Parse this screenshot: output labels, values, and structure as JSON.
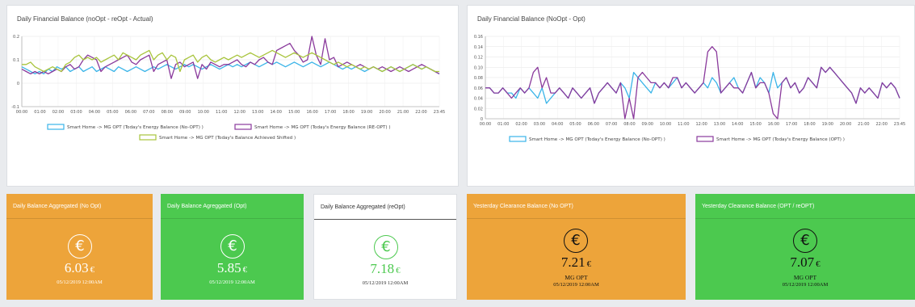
{
  "panels": {
    "left_title": "Daily Financial Balance (noOpt - reOpt - Actual)",
    "right_title": "Daily Financial Balance (NoOpt - Opt)"
  },
  "colors": {
    "blue": "#3ab4e8",
    "purple": "#8a3a9c",
    "olive": "#a8c43c",
    "orange": "#eda43a",
    "green": "#4cc94f"
  },
  "chart_data": [
    {
      "type": "line",
      "title": "Daily Financial Balance (noOpt - reOpt - Actual)",
      "ylim": [
        -0.1,
        0.2
      ],
      "yticks": [
        "0.2",
        "0.1",
        "0",
        "-0.1"
      ],
      "x_ticks": [
        "00:00",
        "01:00",
        "02:00",
        "03:00",
        "04:00",
        "05:00",
        "06:00",
        "07:00",
        "08:00",
        "09:00",
        "10:00",
        "11:00",
        "12:00",
        "13:00",
        "14:00",
        "15:00",
        "16:00",
        "17:00",
        "18:00",
        "19:00",
        "20:00",
        "21:00",
        "22:00",
        "23:45"
      ],
      "grid": true,
      "legend_position": "bottom",
      "series": [
        {
          "name": "Smart Home -> MG OPT (Today's Energy Balance (No-OPT) )",
          "color": "#3ab4e8",
          "values": [
            0.07,
            0.06,
            0.05,
            0.04,
            0.05,
            0.04,
            0.06,
            0.05,
            0.07,
            0.06,
            0.07,
            0.05,
            0.06,
            0.07,
            0.05,
            0.06,
            0.07,
            0.05,
            0.06,
            0.07,
            0.06,
            0.05,
            0.07,
            0.06,
            0.05,
            0.06,
            0.07,
            0.06,
            0.05,
            0.06,
            0.07,
            0.06,
            0.07,
            0.08,
            0.07,
            0.06,
            0.07,
            0.08,
            0.07,
            0.08,
            0.07,
            0.06,
            0.07,
            0.08,
            0.07,
            0.06,
            0.07,
            0.08,
            0.07,
            0.08,
            0.07,
            0.08,
            0.09,
            0.08,
            0.07,
            0.08,
            0.09,
            0.08,
            0.09,
            0.08,
            0.07,
            0.08,
            0.09,
            0.08,
            0.07,
            0.08,
            0.09,
            0.08,
            0.07,
            0.08,
            0.09,
            0.08,
            0.07,
            0.06,
            0.07,
            0.06,
            0.07,
            0.06,
            0.05,
            0.06,
            0.07,
            0.06,
            0.05,
            0.06,
            0.07,
            0.06,
            0.05,
            0.06,
            0.07,
            0.08,
            0.07,
            0.06,
            0.07,
            0.06,
            0.05,
            0.04
          ]
        },
        {
          "name": "Smart Home -> MG OPT (Today's Energy Balance (RE-OPT) )",
          "color": "#8a3a9c",
          "values": [
            0.06,
            0.05,
            0.04,
            0.05,
            0.04,
            0.05,
            0.04,
            0.05,
            0.06,
            0.05,
            0.07,
            0.08,
            0.06,
            0.07,
            0.1,
            0.12,
            0.11,
            0.1,
            0.05,
            0.07,
            0.08,
            0.09,
            0.1,
            0.11,
            0.12,
            0.09,
            0.08,
            0.1,
            0.11,
            0.12,
            0.05,
            0.08,
            0.09,
            0.1,
            0.02,
            0.08,
            0.09,
            0.07,
            0.08,
            0.09,
            0.02,
            0.08,
            0.06,
            0.09,
            0.08,
            0.07,
            0.08,
            0.08,
            0.09,
            0.1,
            0.08,
            0.07,
            0.09,
            0.08,
            0.1,
            0.11,
            0.09,
            0.08,
            0.14,
            0.15,
            0.16,
            0.17,
            0.14,
            0.12,
            0.09,
            0.1,
            0.2,
            0.12,
            0.08,
            0.19,
            0.1,
            0.11,
            0.07,
            0.08,
            0.09,
            0.08,
            0.07,
            0.08,
            0.07,
            0.06,
            0.07,
            0.06,
            0.07,
            0.06,
            0.05,
            0.06,
            0.07,
            0.06,
            0.05,
            0.06,
            0.07,
            0.08,
            0.07,
            0.06,
            0.05,
            0.04
          ]
        },
        {
          "name": "Smart Home -> MG OPT (Today's Balance Achieved Shifted )",
          "color": "#a8c43c",
          "values": [
            0.08,
            0.08,
            0.09,
            0.07,
            0.06,
            0.05,
            0.06,
            0.07,
            0.06,
            0.05,
            0.08,
            0.09,
            0.11,
            0.12,
            0.1,
            0.11,
            0.1,
            0.11,
            0.09,
            0.1,
            0.11,
            0.12,
            0.1,
            0.13,
            0.12,
            0.11,
            0.1,
            0.12,
            0.13,
            0.14,
            0.1,
            0.12,
            0.13,
            0.1,
            0.12,
            0.11,
            0.05,
            0.1,
            0.11,
            0.12,
            0.09,
            0.11,
            0.12,
            0.1,
            0.09,
            0.1,
            0.11,
            0.1,
            0.11,
            0.12,
            0.11,
            0.12,
            0.13,
            0.12,
            0.11,
            0.12,
            0.13,
            0.14,
            0.13,
            0.12,
            0.11,
            0.12,
            0.13,
            0.12,
            0.11,
            0.12,
            0.13,
            0.12,
            0.11,
            0.1,
            0.09,
            0.08,
            0.09,
            0.08,
            0.07,
            0.08,
            0.07,
            0.06,
            0.07,
            0.06,
            0.07,
            0.06,
            0.05,
            0.06,
            0.07,
            0.06,
            0.05,
            0.06,
            0.07,
            0.08,
            0.07,
            0.06,
            0.07,
            0.06,
            0.05,
            0.05
          ]
        }
      ]
    },
    {
      "type": "line",
      "title": "Daily Financial Balance (NoOpt - Opt)",
      "ylim": [
        0,
        0.16
      ],
      "yticks": [
        "0.16",
        "0.14",
        "0.12",
        "0.10",
        "0.08",
        "0.06",
        "0.04",
        "0.02",
        "0"
      ],
      "x_ticks": [
        "00:00",
        "01:00",
        "02:00",
        "03:00",
        "04:00",
        "05:00",
        "06:00",
        "07:00",
        "08:00",
        "09:00",
        "10:00",
        "11:00",
        "12:00",
        "13:00",
        "14:00",
        "15:00",
        "16:00",
        "17:00",
        "18:00",
        "19:00",
        "20:00",
        "21:00",
        "22:00",
        "23:45"
      ],
      "grid": true,
      "legend_position": "bottom",
      "series": [
        {
          "name": "Smart Home -> MG OPT (Today's Energy Balance (No-OPT) )",
          "color": "#3ab4e8",
          "values": [
            0.06,
            0.06,
            0.05,
            0.05,
            0.06,
            0.05,
            0.05,
            0.04,
            0.06,
            0.05,
            0.06,
            0.05,
            0.04,
            0.06,
            0.03,
            0.04,
            0.05,
            0.06,
            0.05,
            0.04,
            0.06,
            0.05,
            0.04,
            0.05,
            0.06,
            0.03,
            0.05,
            0.06,
            0.07,
            0.06,
            0.05,
            0.07,
            0.06,
            0.04,
            0.09,
            0.08,
            0.07,
            0.06,
            0.05,
            0.07,
            0.06,
            0.07,
            0.06,
            0.07,
            0.08,
            0.06,
            0.07,
            0.06,
            0.05,
            0.06,
            0.07,
            0.06,
            0.08,
            0.07,
            0.05,
            0.06,
            0.07,
            0.08,
            0.06,
            0.05,
            0.07,
            0.09,
            0.06,
            0.08,
            0.07,
            0.05,
            0.09,
            0.06,
            0.07,
            0.08,
            0.06,
            0.07,
            0.05,
            0.06,
            0.08,
            0.07,
            0.06,
            0.1,
            0.09,
            0.1,
            0.09,
            0.08,
            0.07,
            0.06,
            0.05,
            0.03,
            0.06,
            0.05,
            0.06,
            0.05,
            0.04,
            0.07,
            0.06,
            0.07,
            0.06,
            0.04
          ]
        },
        {
          "name": "Smart Home -> MG OPT (Today's Energy Balance (OPT) )",
          "color": "#8a3a9c",
          "values": [
            0.06,
            0.06,
            0.05,
            0.05,
            0.06,
            0.05,
            0.04,
            0.05,
            0.06,
            0.05,
            0.06,
            0.09,
            0.1,
            0.06,
            0.08,
            0.05,
            0.05,
            0.06,
            0.05,
            0.04,
            0.06,
            0.05,
            0.04,
            0.05,
            0.06,
            0.03,
            0.05,
            0.06,
            0.07,
            0.06,
            0.05,
            0.07,
            0.0,
            0.04,
            0.0,
            0.08,
            0.09,
            0.08,
            0.07,
            0.07,
            0.06,
            0.07,
            0.06,
            0.08,
            0.08,
            0.06,
            0.07,
            0.06,
            0.05,
            0.06,
            0.07,
            0.13,
            0.14,
            0.13,
            0.05,
            0.06,
            0.07,
            0.06,
            0.06,
            0.05,
            0.07,
            0.09,
            0.06,
            0.07,
            0.07,
            0.05,
            0.01,
            0.0,
            0.07,
            0.08,
            0.06,
            0.07,
            0.05,
            0.06,
            0.08,
            0.07,
            0.06,
            0.1,
            0.09,
            0.1,
            0.09,
            0.08,
            0.07,
            0.06,
            0.05,
            0.03,
            0.06,
            0.05,
            0.06,
            0.05,
            0.04,
            0.07,
            0.06,
            0.07,
            0.06,
            0.04
          ]
        }
      ]
    }
  ],
  "cards": [
    {
      "title": "Daily Balance Aggregated (No Opt)",
      "value": "6.03",
      "currency": "€",
      "line1": "05/12/2019 12:00AM",
      "line2": ""
    },
    {
      "title": "Daily Balance Agreggated (Opt)",
      "value": "5.85",
      "currency": "€",
      "line1": "05/12/2019 12:00AM",
      "line2": ""
    },
    {
      "title": "Daily Balance Aggregated (reOpt)",
      "value": "7.18",
      "currency": "€",
      "line1": "05/12/2019 12:00AM",
      "line2": ""
    },
    {
      "title": "Yesterday Clearance Balance (No OPT)",
      "value": "7.21",
      "currency": "€",
      "line1": "MG OPT",
      "line2": "05/12/2019 12:00AM"
    },
    {
      "title": "Yesterday Clearance Balance (OPT / reOPT)",
      "value": "7.07",
      "currency": "€",
      "line1": "MG OPT",
      "line2": "05/12/2019 12:00AM"
    }
  ],
  "icons": {
    "euro": "€"
  }
}
